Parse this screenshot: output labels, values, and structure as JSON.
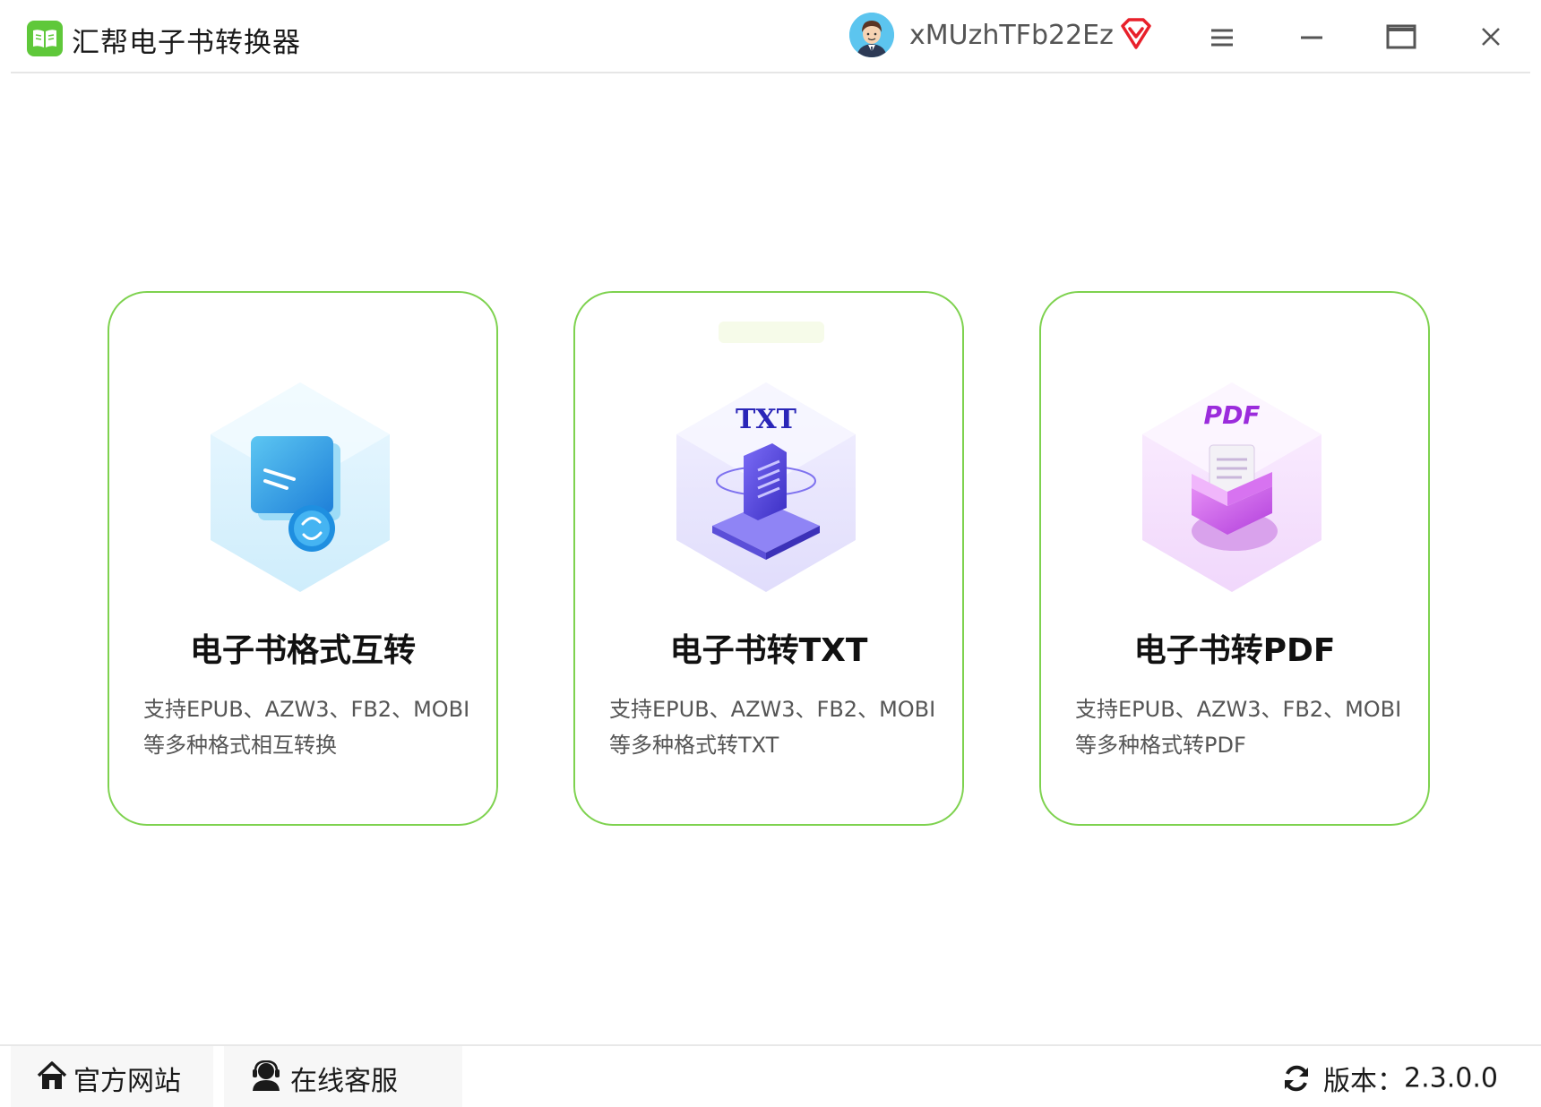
{
  "app": {
    "title": "汇帮电子书转换器",
    "accent_color": "#5fc83a"
  },
  "user": {
    "name": "xMUzhTFb22Ez",
    "vip_icon": "vip-diamond-icon"
  },
  "window_controls": [
    "menu-icon",
    "minimize-icon",
    "maximize-icon",
    "close-icon"
  ],
  "cards": [
    {
      "title": "电子书格式互转",
      "desc_line1": "支持EPUB、AZW3、FB2、MOBI",
      "desc_line2": "等多种格式相互转换",
      "icon": "format-convert-icon"
    },
    {
      "title": "电子书转TXT",
      "desc_line1": "支持EPUB、AZW3、FB2、MOBI",
      "desc_line2": "等多种格式转TXT",
      "icon": "txt-document-icon",
      "icon_label": "TXT"
    },
    {
      "title": "电子书转PDF",
      "desc_line1": "支持EPUB、AZW3、FB2、MOBI",
      "desc_line2": "等多种格式转PDF",
      "icon": "pdf-document-icon",
      "icon_label": "PDF"
    }
  ],
  "footer": {
    "home_label": "官方网站",
    "service_label": "在线客服",
    "version_label": "版本：",
    "version_value": "2.3.0.0"
  }
}
